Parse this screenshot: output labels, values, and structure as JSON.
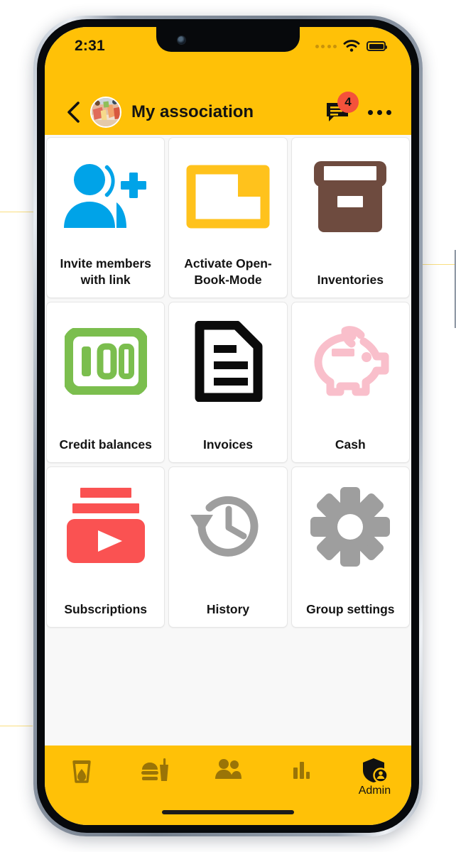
{
  "status_bar": {
    "time": "2:31",
    "signal_icon": "signal-dots-icon",
    "wifi_icon": "wifi-icon",
    "battery_icon": "battery-full-icon"
  },
  "header": {
    "back_icon": "back-chevron-icon",
    "avatar_icon": "group-avatar-photo",
    "title": "My association",
    "chat_icon": "chat-bubble-icon",
    "chat_badge": "4",
    "menu_icon": "more-options-icon",
    "background_color": "#FFC107"
  },
  "grid": {
    "tiles": [
      {
        "label": "Invite members with link",
        "icon": "person-add-icon",
        "color": "#00A3E8"
      },
      {
        "label": "Activate Open-Book-Mode",
        "icon": "folder-open-icon",
        "color": "#FFC21C"
      },
      {
        "label": "Inventories",
        "icon": "archive-box-icon",
        "color": "#6E4B3F"
      },
      {
        "label": "Credit balances",
        "icon": "banknote-100-icon",
        "color": "#7BBE4E"
      },
      {
        "label": "Invoices",
        "icon": "document-lines-icon",
        "color": "#0B0B0B"
      },
      {
        "label": "Cash",
        "icon": "piggy-bank-icon",
        "color": "#F9BFCB"
      },
      {
        "label": "Subscriptions",
        "icon": "subscriptions-play-icon",
        "color": "#FA5252"
      },
      {
        "label": "History",
        "icon": "history-clock-icon",
        "color": "#9E9E9E"
      },
      {
        "label": "Group settings",
        "icon": "gear-icon",
        "color": "#9E9E9E"
      }
    ]
  },
  "tabbar": {
    "background_color": "#FFC107",
    "inactive_color": "#9A7407",
    "active_color": "#111111",
    "items": [
      {
        "label": "",
        "icon": "drink-glass-icon",
        "active": false
      },
      {
        "label": "",
        "icon": "fastfood-icon",
        "active": false
      },
      {
        "label": "",
        "icon": "people-icon",
        "active": false
      },
      {
        "label": "",
        "icon": "bar-chart-icon",
        "active": false
      },
      {
        "label": "Admin",
        "icon": "admin-shield-icon",
        "active": true
      }
    ]
  }
}
